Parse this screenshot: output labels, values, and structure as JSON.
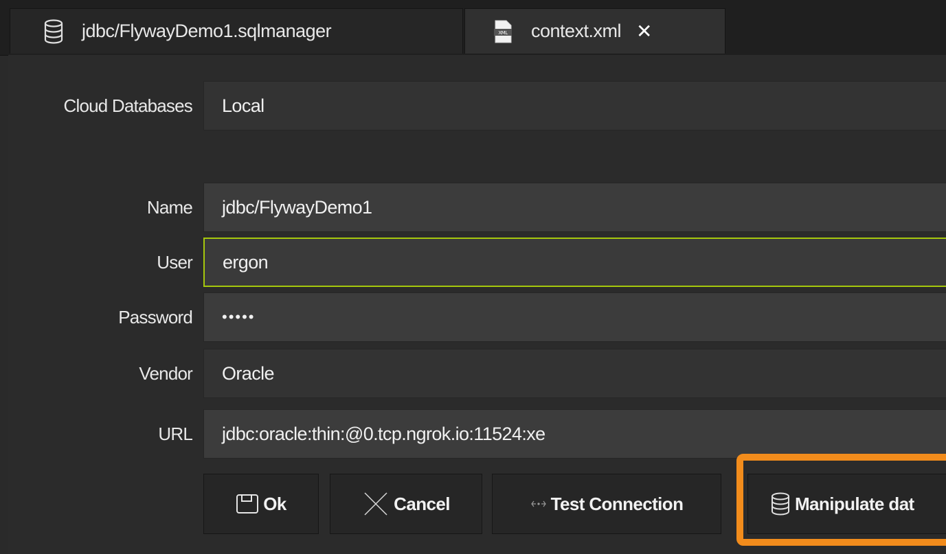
{
  "tabs": [
    {
      "label": "jdbc/FlywayDemo1.sqlmanager",
      "icon": "database-icon"
    },
    {
      "label": "context.xml",
      "icon": "xml-file-icon",
      "close": "✕"
    }
  ],
  "form": {
    "cloud_label": "Cloud Databases",
    "cloud_value": "Local",
    "name_label": "Name",
    "name_value": "jdbc/FlywayDemo1",
    "user_label": "User",
    "user_value": "ergon",
    "password_label": "Password",
    "password_value": "•••••",
    "vendor_label": "Vendor",
    "vendor_value": "Oracle",
    "url_label": "URL",
    "url_value": "jdbc:oracle:thin:@0.tcp.ngrok.io:11524:xe"
  },
  "buttons": {
    "ok": "Ok",
    "cancel": "Cancel",
    "test": "Test Connection",
    "manipulate": "Manipulate dat"
  },
  "colors": {
    "focus": "#a6c80c",
    "highlight": "#f28c1c"
  }
}
